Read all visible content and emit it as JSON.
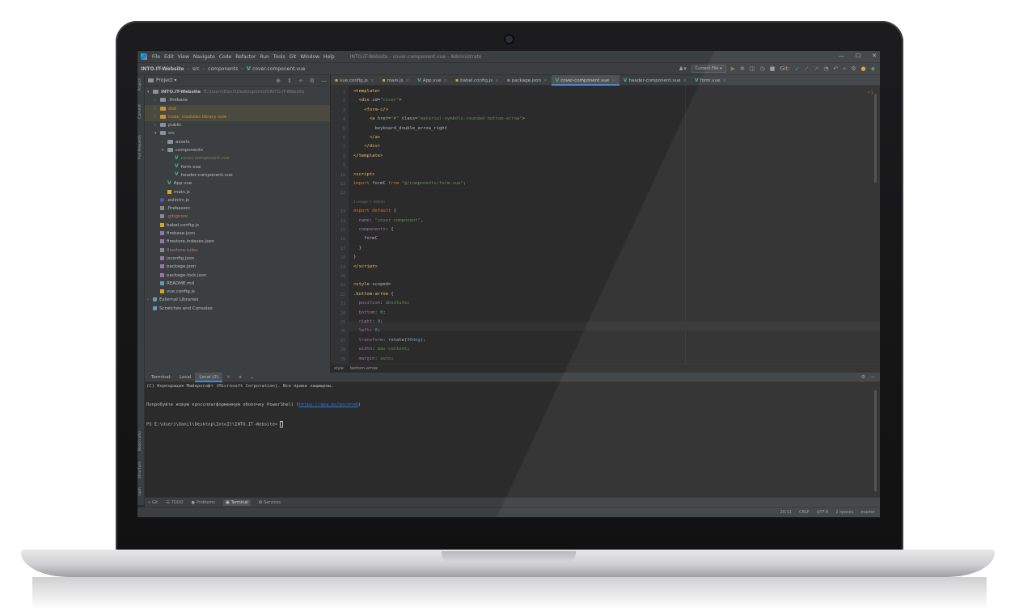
{
  "window": {
    "menu": [
      "File",
      "Edit",
      "View",
      "Navigate",
      "Code",
      "Refactor",
      "Run",
      "Tools",
      "Git",
      "Window",
      "Help"
    ],
    "title": "INTO.IT-Website - cover-component.vue - Administrato",
    "controls": [
      "—",
      "☐",
      "✕"
    ]
  },
  "navbar": {
    "crumbs": [
      "INTO.IT-Website",
      "src",
      "components",
      "cover-component.vue"
    ],
    "run_config": "Current File ▾",
    "user_icon": "user-icon"
  },
  "left_strip": [
    "Project",
    "Commit",
    "Pull Requests",
    "Bookmarks",
    "Structure",
    "npm"
  ],
  "project": {
    "header": "Project ▾",
    "tree": [
      {
        "indent": 0,
        "arrow": "▾",
        "icon": "folder",
        "label": "INTO.IT-Website",
        "extra": "E:\\Users\\Danil\\Desktop\\IntoIt\\INTO.IT-Website",
        "bold": true
      },
      {
        "indent": 1,
        "arrow": "›",
        "icon": "folder",
        "label": ".firebase"
      },
      {
        "indent": 1,
        "arrow": "›",
        "icon": "folder-orange",
        "label": "dist",
        "style": "orange",
        "selected": true
      },
      {
        "indent": 1,
        "arrow": "›",
        "icon": "folder-orange",
        "label": "node_modules  library root",
        "style": "orange",
        "selected": true
      },
      {
        "indent": 1,
        "arrow": "›",
        "icon": "folder",
        "label": "public"
      },
      {
        "indent": 1,
        "arrow": "▾",
        "icon": "folder",
        "label": "src"
      },
      {
        "indent": 2,
        "arrow": "›",
        "icon": "folder",
        "label": "assets"
      },
      {
        "indent": 2,
        "arrow": "▾",
        "icon": "folder",
        "label": "components"
      },
      {
        "indent": 3,
        "arrow": "",
        "icon": "vue",
        "label": "cover-component.vue"
      },
      {
        "indent": 3,
        "arrow": "",
        "icon": "vue",
        "label": "form.vue"
      },
      {
        "indent": 3,
        "arrow": "",
        "icon": "vue",
        "label": "header-component.vue"
      },
      {
        "indent": 2,
        "arrow": "",
        "icon": "vue",
        "label": "App.vue"
      },
      {
        "indent": 2,
        "arrow": "",
        "icon": "js",
        "label": "main.js"
      },
      {
        "indent": 1,
        "arrow": "",
        "icon": "es",
        "label": ".eslintrc.js"
      },
      {
        "indent": 1,
        "arrow": "",
        "icon": "file",
        "label": ".firebaserc"
      },
      {
        "indent": 1,
        "arrow": "",
        "icon": "file",
        "label": ".gitignore"
      },
      {
        "indent": 1,
        "arrow": "",
        "icon": "js",
        "label": "babel.config.js"
      },
      {
        "indent": 1,
        "arrow": "",
        "icon": "json",
        "label": "firebase.json"
      },
      {
        "indent": 1,
        "arrow": "",
        "icon": "json",
        "label": "firestore.indexes.json"
      },
      {
        "indent": 1,
        "arrow": "",
        "icon": "file",
        "label": "firestore.rules"
      },
      {
        "indent": 1,
        "arrow": "",
        "icon": "json",
        "label": "jsconfig.json"
      },
      {
        "indent": 1,
        "arrow": "",
        "icon": "json",
        "label": "package.json"
      },
      {
        "indent": 1,
        "arrow": "",
        "icon": "json",
        "label": "package-lock.json"
      },
      {
        "indent": 1,
        "arrow": "",
        "icon": "md",
        "label": "README.md"
      },
      {
        "indent": 1,
        "arrow": "",
        "icon": "js",
        "label": "vue.config.js"
      },
      {
        "indent": 0,
        "arrow": "›",
        "icon": "lib",
        "label": "External Libraries"
      },
      {
        "indent": 0,
        "arrow": "",
        "icon": "lib",
        "label": "Scratches and Consoles"
      }
    ]
  },
  "tabs": [
    {
      "icon": "js",
      "label": "vue.config.js"
    },
    {
      "icon": "js",
      "label": "main.js"
    },
    {
      "icon": "vue",
      "label": "App.vue"
    },
    {
      "icon": "js",
      "label": "babel.config.js"
    },
    {
      "icon": "json",
      "label": "package.json"
    },
    {
      "icon": "vue",
      "label": "cover-component.vue",
      "active": true
    },
    {
      "icon": "vue",
      "label": "header-component.vue"
    },
    {
      "icon": "vue",
      "label": "form.vue"
    }
  ],
  "editor": {
    "inspection": "✓1",
    "usages_hint": "1 usage   ⚇ Admin",
    "lines": [
      {
        "n": "1",
        "html": "<span class='t-tag'>&lt;template&gt;</span>"
      },
      {
        "n": "2",
        "html": "  <span class='t-tag'>&lt;div </span><span class='t-attr'>id=</span><span class='t-str'>\"cover\"</span><span class='t-tag'>&gt;</span>"
      },
      {
        "n": "3",
        "html": "    <span class='t-tag'>&lt;form-c/&gt;</span>"
      },
      {
        "n": "4",
        "html": "      <span class='t-tag'>&lt;a </span><span class='t-attr'>href=</span><span class='t-str'>\"#\"</span><span class='t-attr'> class=</span><span class='t-str'>\"material-symbols-rounded bottom-arrow\"</span><span class='t-tag'>&gt;</span>"
      },
      {
        "n": "5",
        "html": "        keyboard_double_arrow_right"
      },
      {
        "n": "6",
        "html": "      <span class='t-tag'>&lt;/a&gt;</span>"
      },
      {
        "n": "7",
        "html": "    <span class='t-tag'>&lt;/div&gt;</span>"
      },
      {
        "n": "8",
        "html": "<span class='t-tag'>&lt;/template&gt;</span>"
      },
      {
        "n": "9",
        "html": ""
      },
      {
        "n": "10",
        "html": "<span class='t-tag'>&lt;script&gt;</span>"
      },
      {
        "n": "11",
        "html": "<span class='t-kw'>import </span>formC <span class='t-kw'>from </span><span class='t-str'>\"@/components/form.vue\"</span>;"
      },
      {
        "n": "12",
        "html": ""
      },
      {
        "n": "13",
        "html": "<span class='t-kw'>export default </span>{"
      },
      {
        "n": "14",
        "html": "  <span class='t-prop'>name</span>: <span class='t-str'>\"cover-component\"</span>,"
      },
      {
        "n": "15",
        "html": "  <span class='t-prop'>components</span>: {"
      },
      {
        "n": "16",
        "html": "    formC"
      },
      {
        "n": "17",
        "html": "  }"
      },
      {
        "n": "18",
        "html": "}"
      },
      {
        "n": "19",
        "html": "<span class='t-tag'>&lt;/script&gt;</span>"
      },
      {
        "n": "20",
        "html": ""
      },
      {
        "n": "21",
        "html": "<span class='t-tag'>&lt;style </span><span class='t-attr'>scoped</span><span class='t-tag'>&gt;</span>"
      },
      {
        "n": "22",
        "html": "<span class='t-tag'>.bottom-arrow </span>{"
      },
      {
        "n": "23",
        "html": "  <span class='t-prop'>position</span>: <span class='t-str'>absolute</span>;"
      },
      {
        "n": "24",
        "html": "  <span class='t-prop'>bottom</span>: <span class='t-num'>0</span>;"
      },
      {
        "n": "25",
        "html": "  <span class='t-prop'>right</span>: <span class='t-num'>0</span>;"
      },
      {
        "n": "26",
        "html": "  <span class='t-prop'>left</span>: <span class='t-num'>0</span>;"
      },
      {
        "n": "27",
        "html": "  <span class='t-prop'>transform</span>: rotate(<span class='t-num'>90deg</span>);"
      },
      {
        "n": "28",
        "html": "  <span class='t-prop'>width</span>: <span class='t-str'>max-content</span>;"
      },
      {
        "n": "29",
        "html": "  <span class='t-prop'>margin</span>: <span class='t-str'>auto</span>;"
      }
    ],
    "crumbs": [
      "style",
      "bottom-arrow"
    ]
  },
  "terminal": {
    "label": "Terminal:",
    "tabs": [
      "Local",
      "Local (2)"
    ],
    "line1": "(C) Корпорация Майкрософт (Microsoft Corporation). Все права защищены.",
    "line2_prefix": "Попробуйте новую кроссплатформенную оболочку PowerShell (",
    "line2_link": "https://aka.ms/pscore6",
    "line2_suffix": ")",
    "prompt": "PS E:\\Users\\Danil\\Desktop\\IntoIt\\INTO.IT-Website>"
  },
  "tool_windows": [
    "Git",
    "TODO",
    "Problems",
    "Terminal",
    "Services"
  ],
  "status": [
    "26:11",
    "CRLF",
    "UTF-8",
    "2 spaces",
    "master"
  ]
}
